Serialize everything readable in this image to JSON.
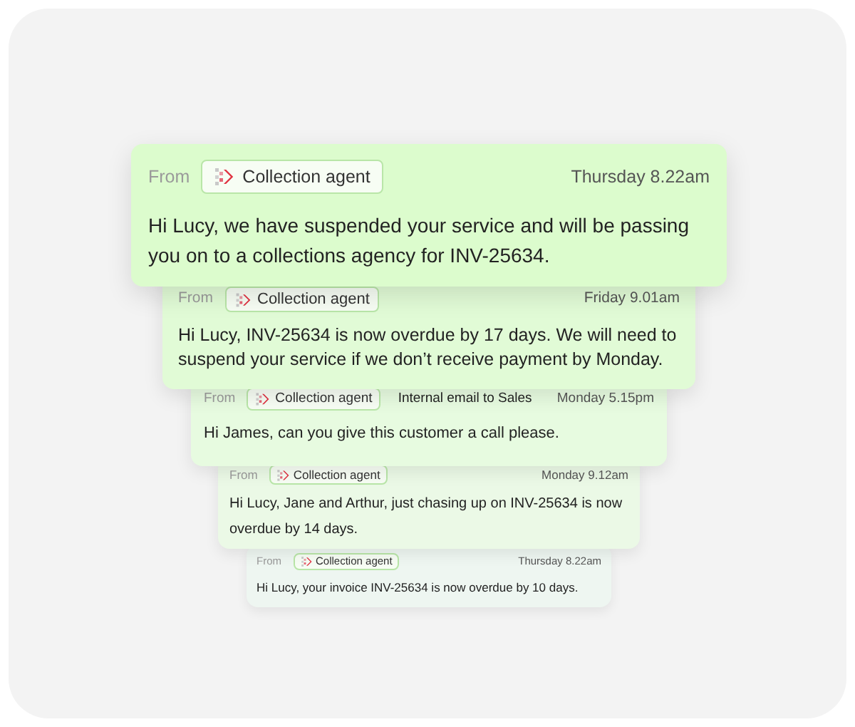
{
  "messages": [
    {
      "from_label": "From",
      "sender": "Collection agent",
      "time": "Thursday 8.22am",
      "text": "Hi Lucy, we have suspended your service and will be passing you on to a collections agency for INV-25634."
    },
    {
      "from_label": "From",
      "sender": "Collection agent",
      "time": "Friday 9.01am",
      "text": "Hi Lucy, INV-25634 is now overdue by 17 days. We will need to suspend your service if we don’t receive payment by Monday."
    },
    {
      "from_label": "From",
      "sender": "Collection agent",
      "note": "Internal email to Sales",
      "time": "Monday 5.15pm",
      "text": "Hi James, can you give this customer a call please."
    },
    {
      "from_label": "From",
      "sender": "Collection agent",
      "time": "Monday 9.12am",
      "text": "Hi Lucy, Jane and Arthur, just chasing up on INV-25634 is now overdue by 14 days."
    },
    {
      "from_label": "From",
      "sender": "Collection agent",
      "time": "Thursday 8.22am",
      "text": "Hi Lucy, your invoice INV-25634 is now overdue by 10 days."
    }
  ]
}
